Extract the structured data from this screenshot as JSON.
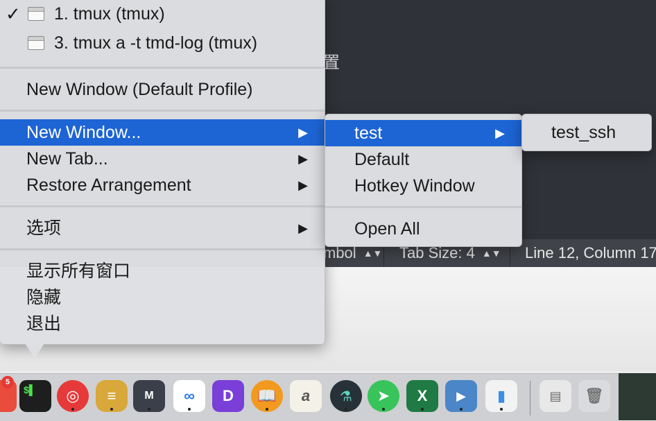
{
  "background": {
    "editor_glyph": "置",
    "statusbar": {
      "symbol_label": "mbol",
      "tab_size_label": "Tab Size: 4",
      "position_label": "Line 12, Column 17"
    }
  },
  "main_menu": {
    "windows": [
      {
        "label": "1. tmux (tmux)",
        "checked": true
      },
      {
        "label": "3. tmux a -t tmd-log (tmux)",
        "checked": false
      }
    ],
    "new_window_default": "New Window (Default Profile)",
    "new_window": "New Window...",
    "new_tab": "New Tab...",
    "restore_arrangement": "Restore Arrangement",
    "options": "选项",
    "show_all_windows": "显示所有窗口",
    "hide": "隐藏",
    "quit": "退出",
    "check_glyph": "✓",
    "submenu_arrow": "▶"
  },
  "profiles_submenu": {
    "items": [
      "test",
      "Default",
      "Hotkey Window"
    ],
    "open_all": "Open All"
  },
  "test_submenu": {
    "items": [
      "test_ssh"
    ]
  },
  "dock": {
    "badge_count": "5",
    "icons": [
      "calendar-icon",
      "terminal-icon",
      "netease-music-icon",
      "sequel-pro-icon",
      "markdown-editor-icon",
      "baidu-netdisk-icon",
      "dash-icon",
      "ibooks-icon",
      "signature-icon",
      "instruments-icon",
      "send-icon",
      "excel-icon",
      "quicktime-icon",
      "numbers-icon",
      "finder-window-icon",
      "trash-icon"
    ]
  },
  "colors": {
    "highlight": "#1d64d4",
    "menu_bg": "#dedfe2",
    "editor_bg": "#2f3238"
  }
}
